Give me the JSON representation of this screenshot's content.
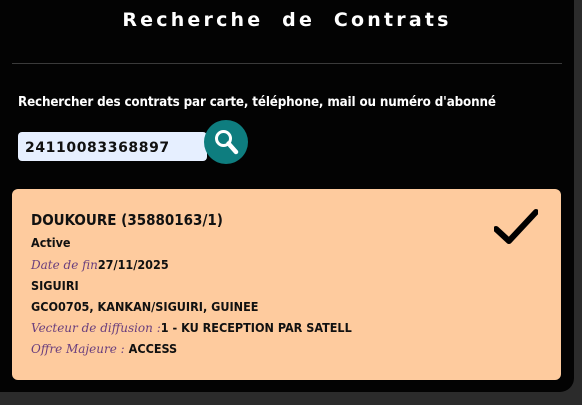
{
  "header": {
    "title": "Recherche de Contrats"
  },
  "search": {
    "label": "Rechercher des contrats par carte, téléphone, mail ou numéro d'abonné",
    "value": "24110083368897",
    "button_icon": "search-icon"
  },
  "result": {
    "name": "DOUKOURE (35880163/1)",
    "status": "Active",
    "end_date_label": "Date de fin",
    "end_date": "27/11/2025",
    "city": "SIGUIRI",
    "address": "GCO0705, KANKAN/SIGUIRI, GUINEE",
    "vector_label": "Vecteur de diffusion :",
    "vector_value": "1 - KU RECEPTION PAR SATELL",
    "offer_label": "Offre Majeure :",
    "offer_value": "ACCESS",
    "status_icon": "checkmark-icon"
  },
  "colors": {
    "panel_bg": "#030303",
    "card_bg": "#fecb9e",
    "input_bg": "#e6efff",
    "search_button": "#0e7d7f",
    "label_purple": "#6a3f7e"
  }
}
